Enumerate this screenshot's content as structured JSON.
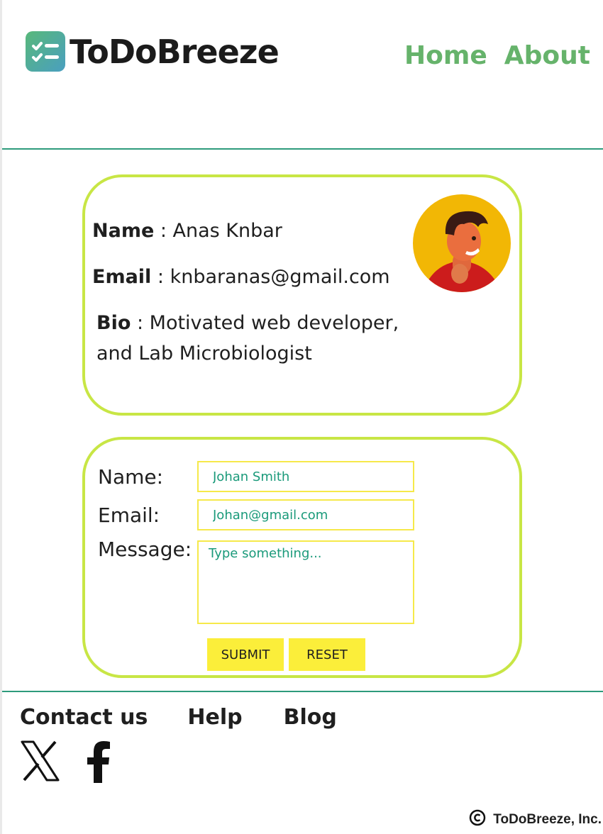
{
  "header": {
    "brand": "ToDoBreeze",
    "nav": [
      "Home",
      "About"
    ]
  },
  "profile": {
    "name_label": "Name",
    "name_value": " : Anas Knbar",
    "email_label": "Email",
    "email_value": " : knbaranas@gmail.com",
    "bio_label": "Bio",
    "bio_value_line1": " : Motivated web developer,",
    "bio_value_line2": "and Lab Microbiologist"
  },
  "form": {
    "name_label": "Name:",
    "name_value": "Johan Smith",
    "email_label": "Email:",
    "email_value": "Johan@gmail.com",
    "message_label": "Message:",
    "message_placeholder": "Type something...",
    "submit_label": "SUBMIT",
    "reset_label": "RESET"
  },
  "footer": {
    "links": [
      "Contact us",
      "Help",
      "Blog"
    ],
    "social": [
      "x-icon",
      "facebook-icon"
    ],
    "copyright": "ToDoBreeze, Inc."
  },
  "colors": {
    "accent_green": "#66b36b",
    "divider": "#2e9b7c",
    "card_border": "#c8e645",
    "input_border": "#f6e94a",
    "button": "#fbee3a",
    "input_text": "#1a9a7a",
    "avatar_bg": "#f2b705"
  }
}
